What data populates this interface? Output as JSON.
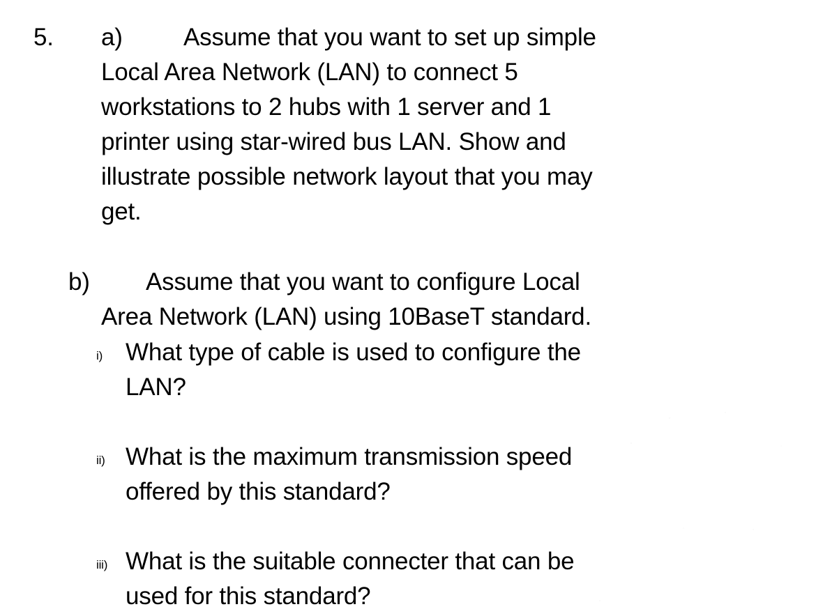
{
  "document": {
    "type": "scanned-exam-question",
    "background_color": "#ffffff",
    "text_color": "#000000"
  },
  "question": {
    "number": "5.",
    "parts": [
      {
        "label": "a)",
        "lines": [
          "Assume that you want to set up simple",
          "Local Area Network (LAN) to connect 5",
          "workstations to 2 hubs with 1 server and 1",
          "printer using star-wired bus LAN. Show and",
          "illustrate possible network layout that you may",
          "get."
        ],
        "text": "Assume that you want to set up simple Local Area Network (LAN) to connect 5 workstations to 2 hubs with 1 server and 1 printer using star-wired bus LAN. Show and illustrate possible network layout that you may get."
      },
      {
        "label": "b)",
        "lines": [
          "Assume that you want to configure Local",
          "Area Network (LAN) using 10BaseT standard."
        ],
        "text": "Assume that you want to configure Local Area Network (LAN) using 10BaseT standard.",
        "subitems": [
          {
            "marker": "i)",
            "line1": "What type of cable is used to configure the",
            "line2": "LAN?",
            "text": "What type of cable is used to configure the LAN?"
          },
          {
            "marker": "ii)",
            "line1": "What is the maximum transmission speed",
            "line2": "offered by this standard?",
            "text": "What is the maximum transmission speed offered by this standard?"
          },
          {
            "marker": "iii)",
            "line1": "What is the suitable connecter that can be",
            "line2": "used for this standard?",
            "text": "What is the suitable connecter that can be used for this standard?"
          }
        ]
      }
    ]
  }
}
